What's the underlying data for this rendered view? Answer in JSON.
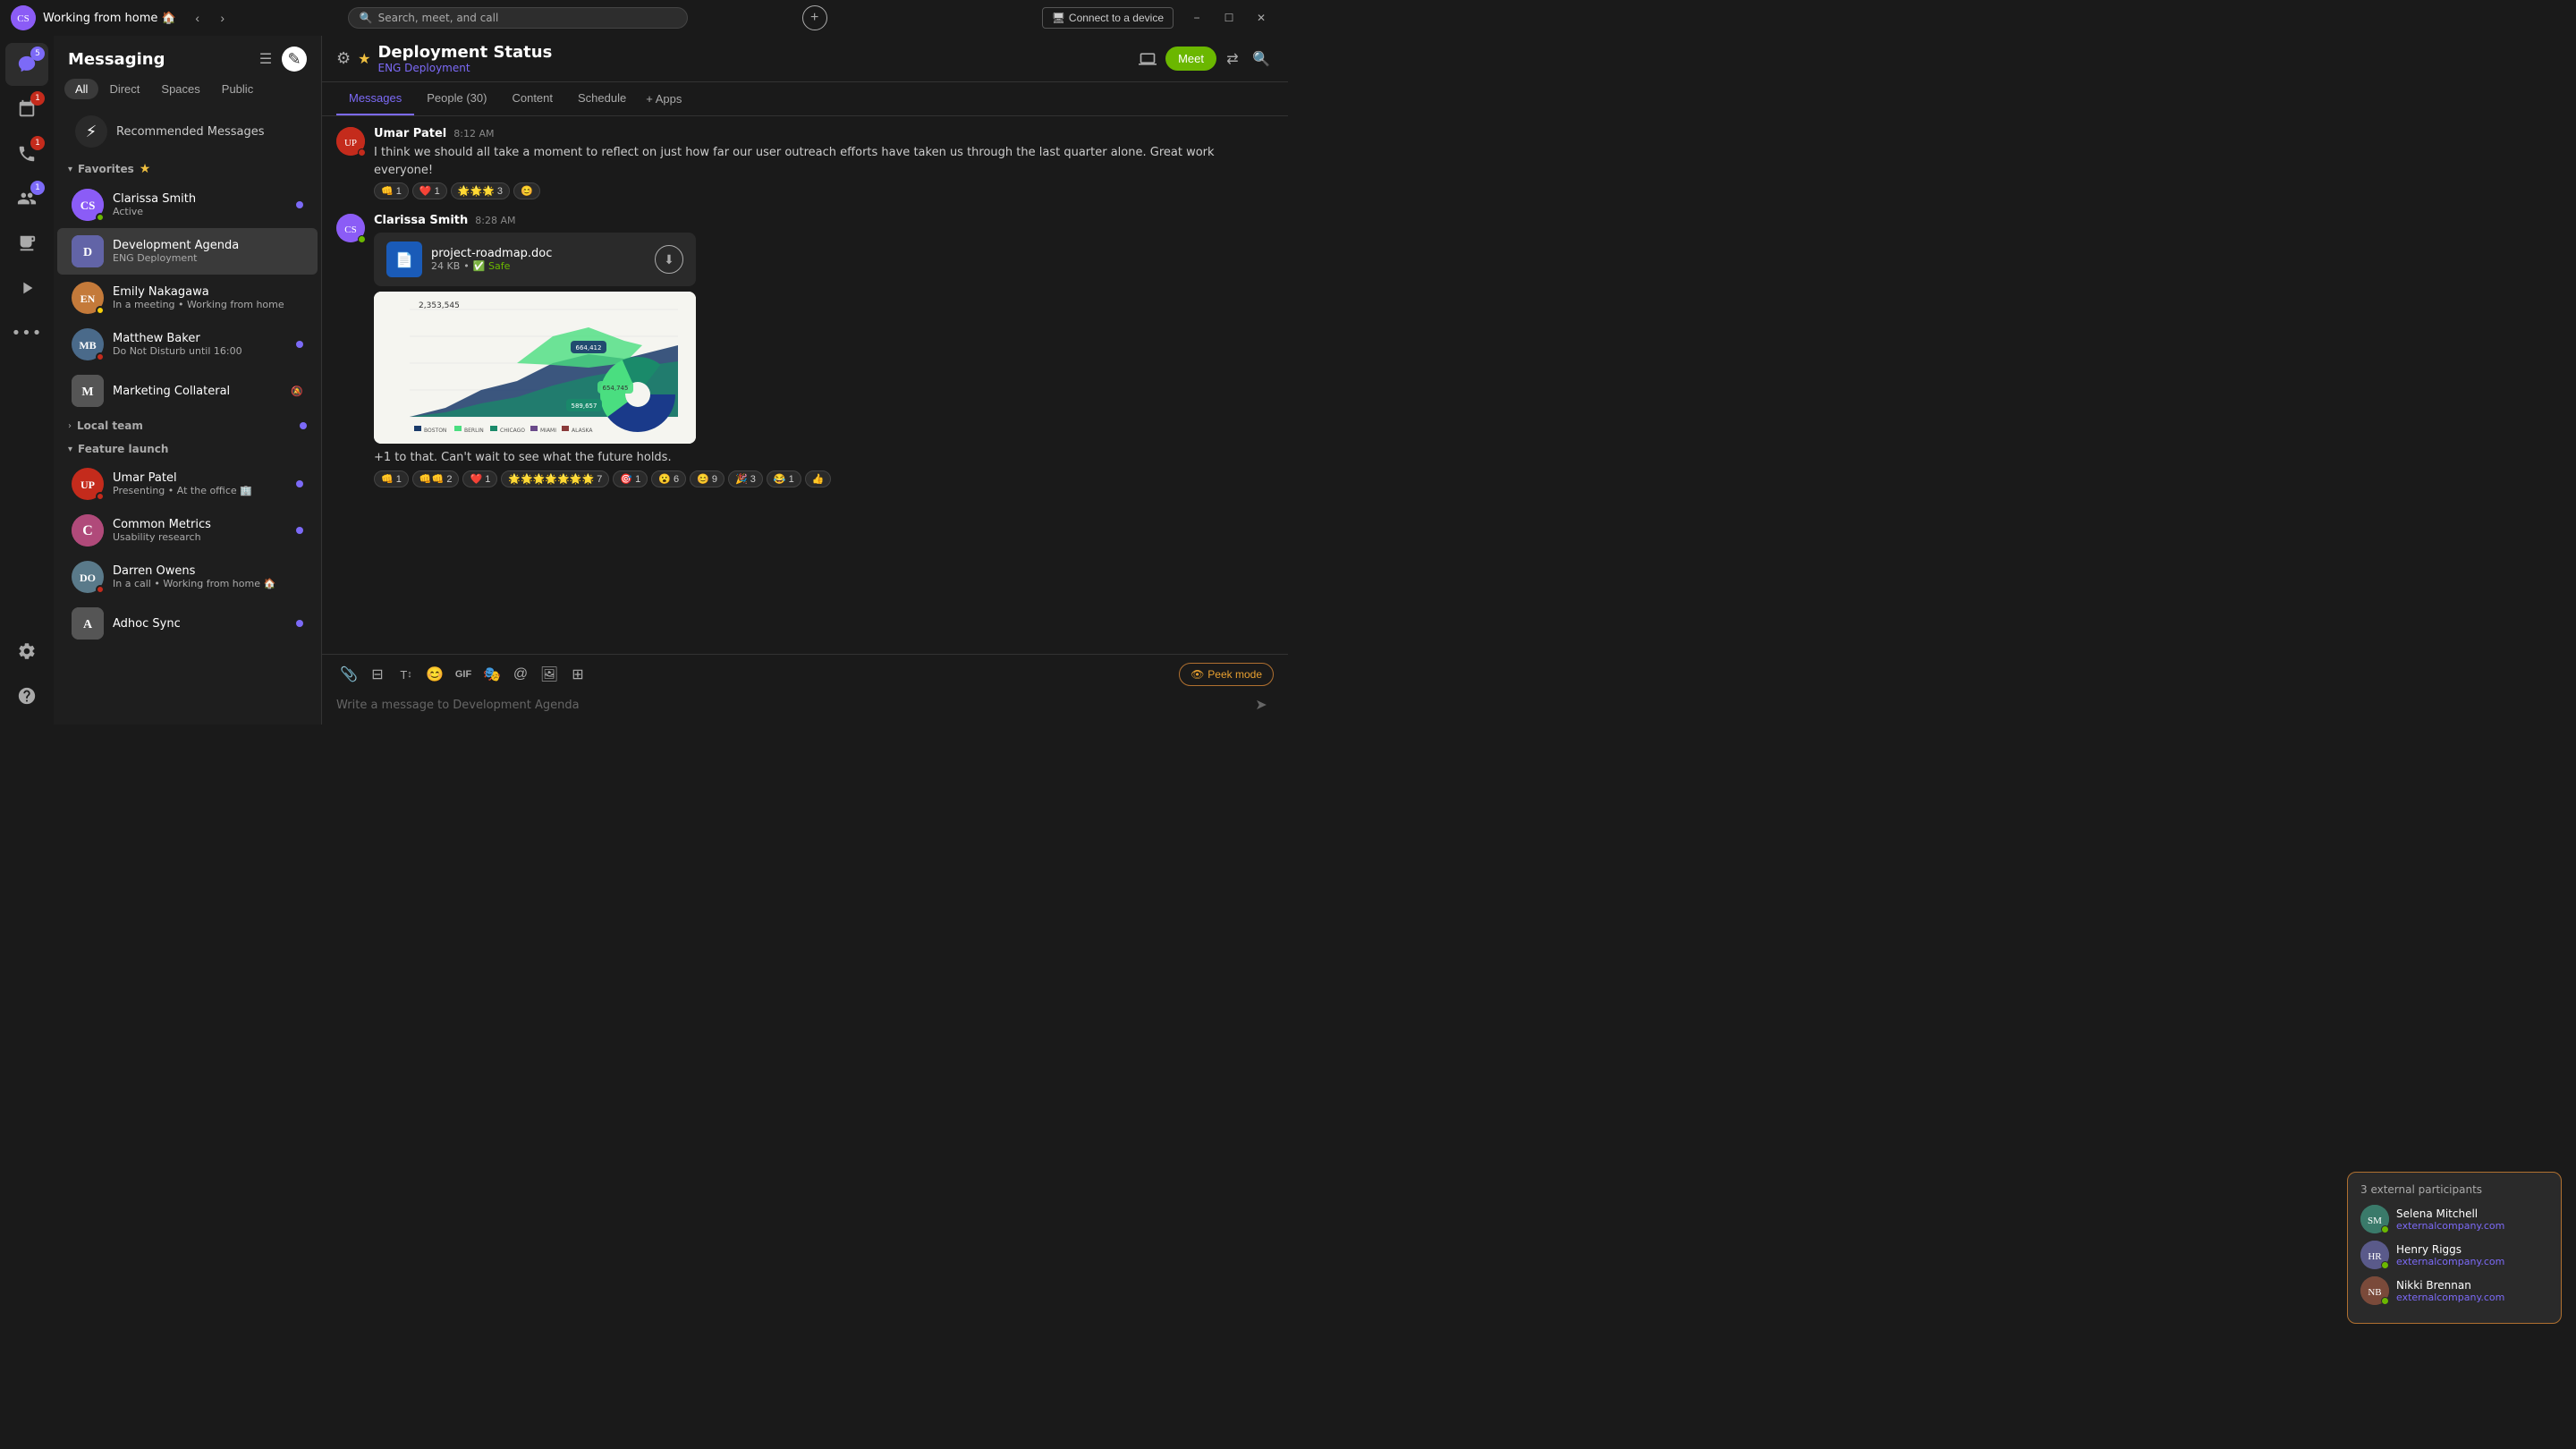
{
  "titlebar": {
    "avatar_initials": "C",
    "title": "Working from home 🏠",
    "search_placeholder": "Search, meet, and call",
    "connect_device": "Connect to a device",
    "window_controls": [
      "−",
      "☐",
      "✕"
    ]
  },
  "sidebar": {
    "icons": [
      {
        "name": "chat-icon",
        "symbol": "💬",
        "badge": "5",
        "badge_type": "purple"
      },
      {
        "name": "calendar-icon",
        "symbol": "📅",
        "badge": "1",
        "badge_type": "red"
      },
      {
        "name": "calls-icon",
        "symbol": "📞",
        "badge": "1",
        "badge_type": "red"
      },
      {
        "name": "teams-icon",
        "symbol": "👥",
        "badge": "1",
        "badge_type": "purple"
      },
      {
        "name": "contacts-icon",
        "symbol": "📋",
        "badge": null
      },
      {
        "name": "activity-icon",
        "symbol": "▶",
        "badge": null
      },
      {
        "name": "more-icon",
        "symbol": "•••",
        "badge": null
      }
    ],
    "bottom": [
      {
        "name": "settings-icon",
        "symbol": "⚙"
      },
      {
        "name": "help-icon",
        "symbol": "?"
      }
    ]
  },
  "messaging": {
    "title": "Messaging",
    "filter_tabs": [
      "All",
      "Direct",
      "Spaces",
      "Public"
    ],
    "active_tab": "All",
    "recommended": {
      "label": "Recommended Messages"
    },
    "sections": {
      "favorites": {
        "label": "Favorites",
        "expanded": true,
        "items": [
          {
            "name": "Clarissa Smith",
            "sub": "Active",
            "avatar_bg": "#8b5cf6",
            "avatar_initials": "CS",
            "status": "active",
            "has_photo": true,
            "unread": true
          },
          {
            "name": "Development Agenda",
            "sub": "ENG Deployment",
            "avatar_bg": "#6264a7",
            "avatar_initials": "D",
            "status": null,
            "unread": false,
            "active": true
          },
          {
            "name": "Emily Nakagawa",
            "sub": "In a meeting • Working from home",
            "avatar_bg": "#c47a3a",
            "avatar_initials": "EN",
            "status": "away",
            "has_photo": true,
            "unread": false
          },
          {
            "name": "Matthew Baker",
            "sub": "Do Not Disturb until 16:00",
            "avatar_bg": "#555",
            "avatar_initials": "MB",
            "status": "dnd",
            "has_photo": true,
            "unread": true
          },
          {
            "name": "Marketing Collateral",
            "sub": "",
            "avatar_bg": "#555",
            "avatar_initials": "M",
            "status": null,
            "unread": false,
            "muted": true
          }
        ]
      },
      "local_team": {
        "label": "Local team",
        "expanded": false,
        "has_unread": true
      },
      "feature_launch": {
        "label": "Feature launch",
        "expanded": true,
        "items": [
          {
            "name": "Umar Patel",
            "sub": "Presenting • At the office 🏢",
            "avatar_bg": "#c42b1c",
            "avatar_initials": "UP",
            "status": "busy",
            "has_photo": true,
            "unread": true
          },
          {
            "name": "Common Metrics",
            "sub": "Usability research",
            "avatar_bg": "#b04a7a",
            "avatar_initials": "C",
            "status": null,
            "unread": true
          },
          {
            "name": "Darren Owens",
            "sub": "In a call • Working from home 🏠",
            "avatar_bg": "#555",
            "avatar_initials": "DO",
            "status": "in-call",
            "has_photo": true,
            "unread": false
          },
          {
            "name": "Adhoc Sync",
            "sub": "",
            "avatar_bg": "#555",
            "avatar_initials": "A",
            "status": null,
            "unread": true
          }
        ]
      }
    }
  },
  "chat": {
    "title": "Deployment Status",
    "subtitle": "ENG Deployment",
    "tabs": [
      "Messages",
      "People (30)",
      "Content",
      "Schedule",
      "+ Apps"
    ],
    "active_tab": "Messages",
    "messages": [
      {
        "sender": "Umar Patel",
        "time": "8:12 AM",
        "avatar_bg": "#c42b1c",
        "avatar_initials": "UP",
        "text": "I think we should all take a moment to reflect on just how far our user outreach efforts have taken us through the last quarter alone. Great work everyone!",
        "reactions": [
          {
            "emoji": "👊",
            "count": "1"
          },
          {
            "emoji": "❤️",
            "count": "1"
          },
          {
            "emoji": "🌟🌟🌟",
            "count": "3"
          },
          {
            "emoji": "😊",
            "count": ""
          }
        ]
      },
      {
        "sender": "Clarissa Smith",
        "time": "8:28 AM",
        "avatar_bg": "#8b5cf6",
        "avatar_initials": "CS",
        "has_file": true,
        "file": {
          "name": "project-roadmap.doc",
          "size": "24 KB",
          "safe": true,
          "safe_label": "Safe"
        },
        "has_chart": true,
        "chart_value": "2,353,545",
        "text": "+1 to that. Can't wait to see what the future holds.",
        "reactions": [
          {
            "emoji": "👊",
            "count": "1"
          },
          {
            "emoji": "👊👊",
            "count": "2"
          },
          {
            "emoji": "❤️",
            "count": "1"
          },
          {
            "emoji": "🌟🌟🌟🌟🌟🌟🌟",
            "count": "7"
          },
          {
            "emoji": "🎯",
            "count": "1"
          },
          {
            "emoji": "😮",
            "count": "6"
          },
          {
            "emoji": "😊",
            "count": "9"
          },
          {
            "emoji": "🎉",
            "count": "3"
          },
          {
            "emoji": "😂",
            "count": "1"
          },
          {
            "emoji": "👍",
            "count": ""
          }
        ]
      }
    ],
    "message_input_placeholder": "Write a message to Development Agenda",
    "toolbar_icons": [
      {
        "name": "attach-icon",
        "symbol": "📎"
      },
      {
        "name": "format-icon",
        "symbol": "⊟"
      },
      {
        "name": "format-text-icon",
        "symbol": "T↕"
      },
      {
        "name": "emoji-icon",
        "symbol": "😊"
      },
      {
        "name": "gif-icon",
        "symbol": "GIF"
      },
      {
        "name": "sticker-icon",
        "symbol": "🎭"
      },
      {
        "name": "mention-icon",
        "symbol": "@"
      },
      {
        "name": "image-icon",
        "symbol": "🖼"
      },
      {
        "name": "more-icon",
        "symbol": "⊞"
      }
    ],
    "peek_mode_label": "Peek mode"
  },
  "external_popup": {
    "title": "3 external participants",
    "participants": [
      {
        "name": "Selena Mitchell",
        "domain": "externalcompany.com",
        "avatar_bg": "#3a7a6a",
        "avatar_initials": "SM",
        "online": true
      },
      {
        "name": "Henry Riggs",
        "domain": "externalcompany.com",
        "avatar_bg": "#5a5a8a",
        "avatar_initials": "HR",
        "online": true
      },
      {
        "name": "Nikki Brennan",
        "domain": "externalcompany.com",
        "avatar_bg": "#7a4a3a",
        "avatar_initials": "NB",
        "online": true
      }
    ]
  },
  "colors": {
    "accent_purple": "#7c6af7",
    "accent_green": "#6bb700",
    "accent_red": "#c42b1c",
    "accent_yellow": "#f0c040",
    "accent_orange": "#b07030",
    "bg_dark": "#1a1a1a",
    "bg_panel": "#1e1e1e",
    "bg_item": "#2a2a2a",
    "bg_active": "#3a3a3a"
  }
}
